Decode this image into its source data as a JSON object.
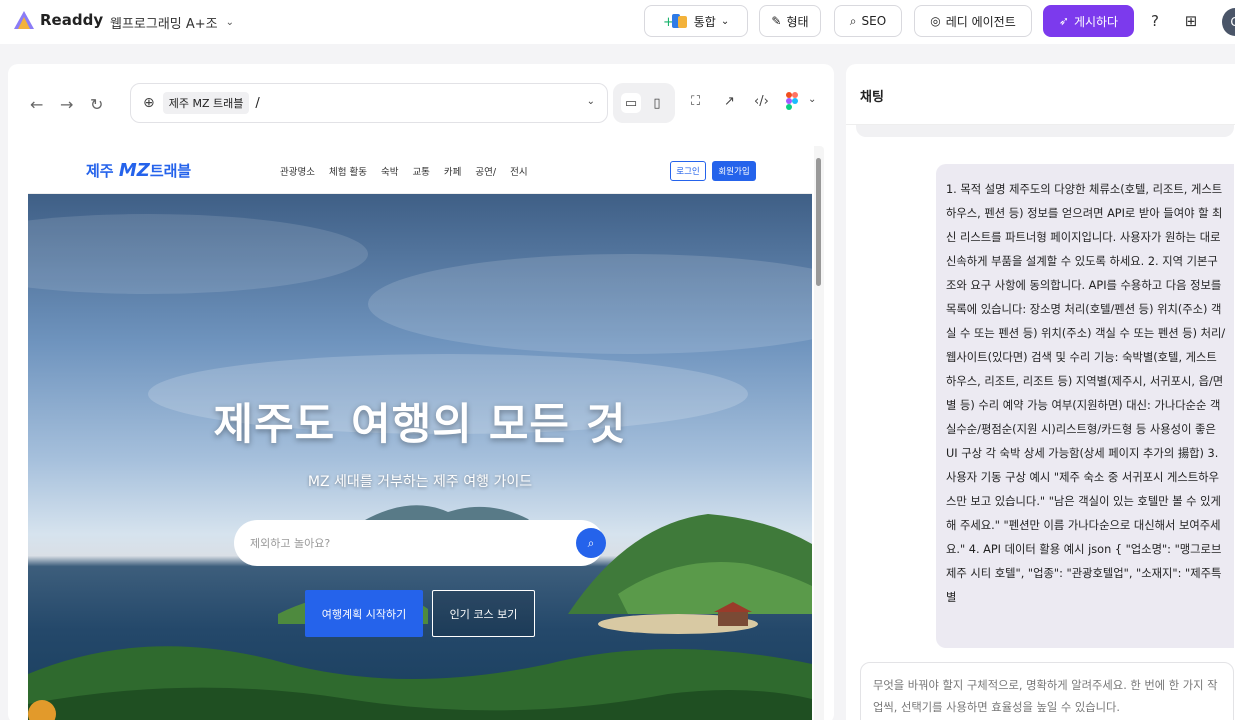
{
  "app": {
    "brand": "Readdy",
    "project": "웹프로그래밍 A+조",
    "toolbar": {
      "integration_label": "통합",
      "form_label": "형태",
      "seo_label": "SEO",
      "agent_label": "레디 에이전트",
      "publish_label": "게시하다",
      "avatar_label": "G"
    },
    "accent_color": "#7c3aed"
  },
  "preview": {
    "site_chip": "제주 MZ 트래블",
    "path": "/",
    "website": {
      "logo_prefix": "제주",
      "logo_mz": "MZ",
      "logo_suffix": "트래블",
      "menu": [
        "관광명소",
        "체험 활동",
        "숙박",
        "교통",
        "카페",
        "공연/",
        "전시"
      ],
      "login_label": "로그인",
      "signup_label": "회원가입",
      "hero_title": "제주도 여행의 모든 것",
      "hero_subtitle": "MZ 세대를 거부하는 제주 여행 가이드",
      "search_placeholder": "제외하고 놀아요?",
      "cta_primary": "여행계획 시작하기",
      "cta_secondary": "인기 코스 보기",
      "brand_color": "#2563eb"
    }
  },
  "chat": {
    "title": "채팅",
    "message": "1. 목적 설명 제주도의 다양한 체류소(호텔, 리조트, 게스트하우스, 펜션 등) 정보를 얻으려면 API로 받아 들여야 할 최신 리스트를 파트너형 페이지입니다. 사용자가 원하는 대로 신속하게 부품을 설계할 수 있도록 하세요. 2. 지역 기본구조와 요구 사항에 동의합니다. API를 수용하고 다음 정보를 목록에 있습니다: 장소명 처리(호텔/펜션 등) 위치(주소) 객실 수 또는 펜션 등) 위치(주소) 객실 수 또는 펜션 등) 처리/웹사이트(있다면) 검색 및 수리 기능: 숙박별(호텔, 게스트하우스, 리조트, 리조트 등) 지역별(제주시, 서귀포시, 읍/면별 등) 수리 예약 가능 여부(지원하면) 대신: 가나다순순 객실수순/평점순(지원 시)리스트형/카드형 등 사용성이 좋은 UI 구상 각 숙박 상세 가능함(상세 페이지 추가의 揚합) 3. 사용자 기동 구상 예시 \"제주 숙소 중 서귀포시 게스트하우스만 보고 있습니다.\" \"남은 객실이 있는 호텔만 볼 수 있게 해 주세요.\" \"펜션만 이름 가나다순으로 대신해서 보여주세요.\" 4. API 데이터 활용 예시 json { \"업소명\": \"맹그로브 제주 시티 호텔\", \"업종\": \"관광호텔업\", \"소재지\": \"제주특별",
    "composer_placeholder": "무엇을 바꿔야 할지 구체적으로, 명확하게 알려주세요. 한 번에 한 가지 작업씩, 선택기를 사용하면 효율성을 높일 수 있습니다."
  }
}
